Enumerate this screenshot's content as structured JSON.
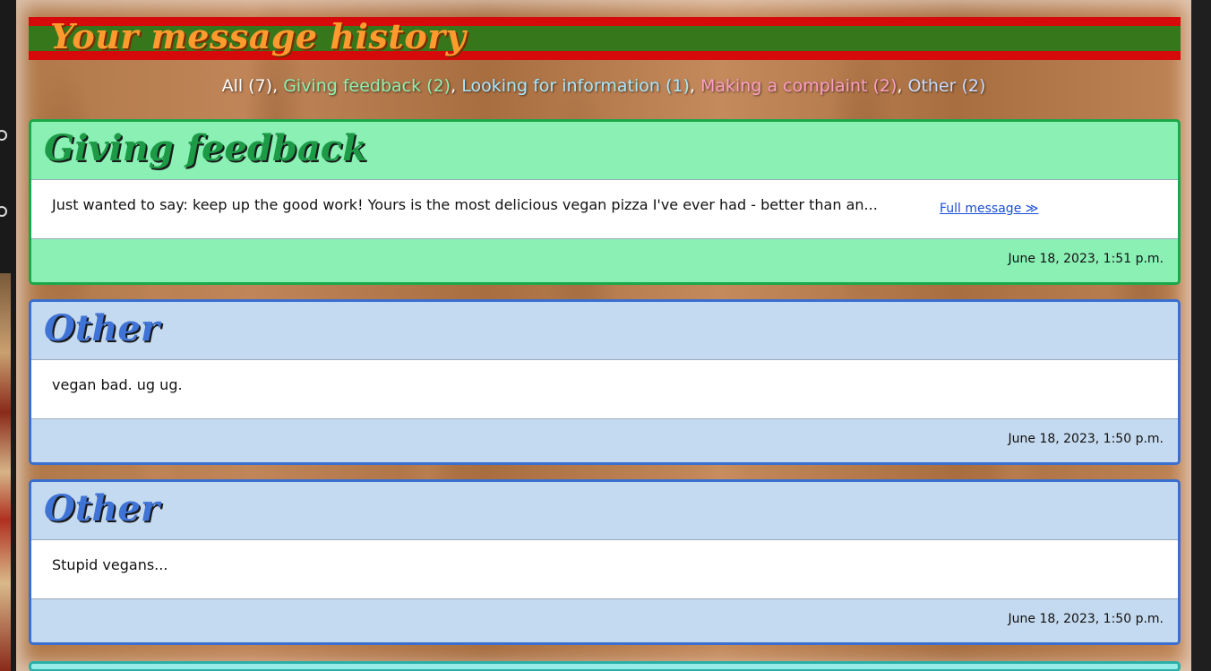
{
  "page": {
    "title": "Your message history"
  },
  "filters": {
    "all": "All (7)",
    "feedback": "Giving feedback (2)",
    "information": "Looking for information (1)",
    "complaint": "Making a complaint (2)",
    "other": "Other (2)",
    "separator": ", "
  },
  "messages": [
    {
      "category": "Giving feedback",
      "text": "Just wanted to say: keep up the good work! Yours is the most delicious vegan pizza I've ever had - better than an...",
      "link": "Full message ≫",
      "timestamp": "June 18, 2023, 1:51 p.m."
    },
    {
      "category": "Other",
      "text": "vegan bad. ug ug.",
      "timestamp": "June 18, 2023, 1:50 p.m."
    },
    {
      "category": "Other",
      "text": "Stupid vegans...",
      "timestamp": "June 18, 2023, 1:50 p.m."
    }
  ],
  "colors": {
    "feedback": "#8af0b4",
    "other": "#c4daf0",
    "title_bar_red": "#d60a0a",
    "title_bar_green": "#36771c",
    "title_text": "#ff9b2e"
  }
}
